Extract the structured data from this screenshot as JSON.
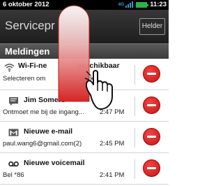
{
  "status_bar": {
    "date": "6 oktober 2012",
    "network": "4G",
    "time": "11:23"
  },
  "title_bar": {
    "title": "Servicepr",
    "help_button": "Helder"
  },
  "section": {
    "label": "Meldingen"
  },
  "notifications": [
    {
      "icon": "wifi-icon",
      "title": "Wi-Fi-ne",
      "title_rest": "beschikbaar",
      "subtitle": "Selecteren om",
      "subtitle_rest": "werk...",
      "time": ""
    },
    {
      "icon": "message-icon",
      "title": "Jim Somers",
      "subtitle": "Ontmoet me bij de ingang...",
      "time": "2:47 PM"
    },
    {
      "icon": "gmail-icon",
      "title": "Nieuwe e-mail",
      "subtitle": "paul.wang6@gmail.com(2)",
      "time": "2:45 PM"
    },
    {
      "icon": "voicemail-icon",
      "title": "Nieuwe voicemail",
      "subtitle": "Bel *86",
      "time": "2:41 PM"
    }
  ],
  "colors": {
    "delete": "#d41a1a",
    "gesture_arrow": "#e03434",
    "battery": "#2ab34a",
    "signal": "#2f9bd3"
  }
}
